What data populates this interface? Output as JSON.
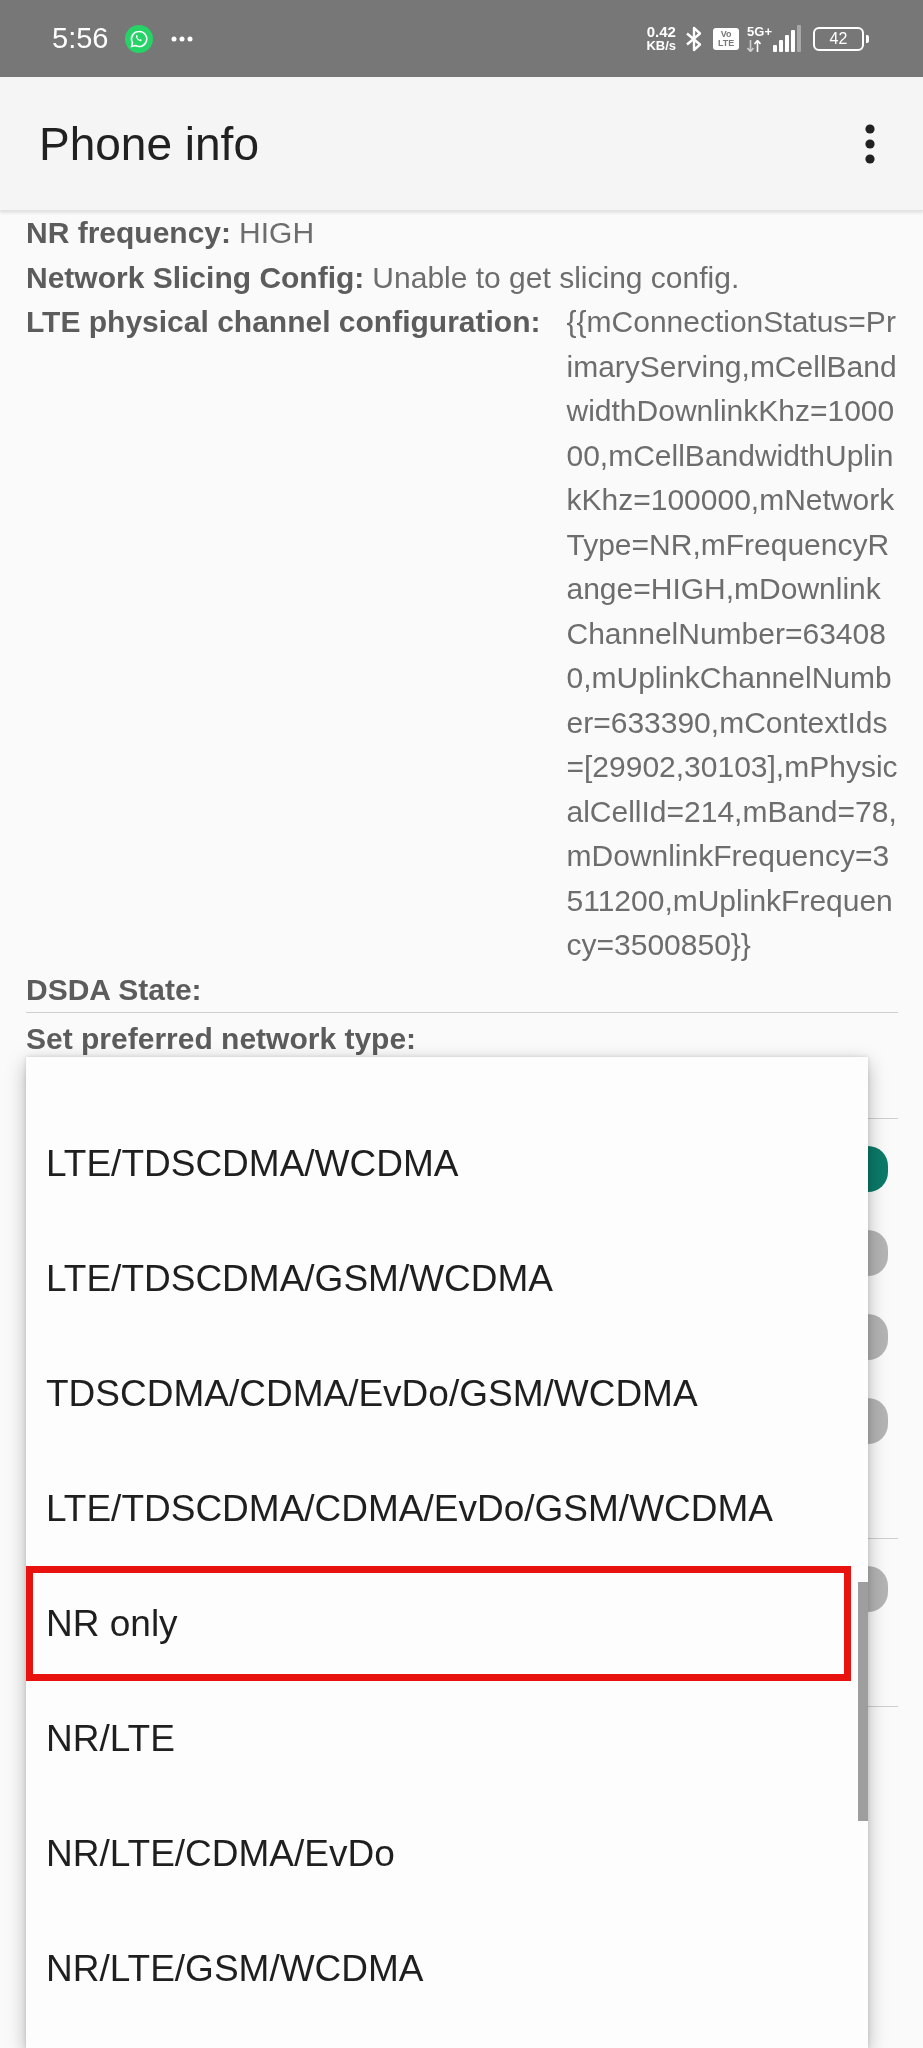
{
  "status_bar": {
    "time": "5:56",
    "speed_value": "0.42",
    "speed_unit": "KB/s",
    "volte_top": "Vo",
    "volte_bottom": "LTE",
    "network_type": "5G+",
    "battery": "42"
  },
  "app_bar": {
    "title": "Phone info"
  },
  "info_rows": [
    {
      "kind": "inline",
      "label": "NR frequency:",
      "value": "HIGH"
    },
    {
      "kind": "inline",
      "label": "Network Slicing Config:",
      "value": "Unable to get slicing config."
    },
    {
      "kind": "column",
      "label": "LTE physical channel configuration:",
      "value": "{{mConnectionStatus=PrimaryServing,mCellBandwidthDownlinkKhz=100000,mCellBandwidthUplinkKhz=100000,mNetworkType=NR,mFrequencyRange=HIGH,mDownlinkChannelNumber=634080,mUplinkChannelNumber=633390,mContextIds=[29902,30103],mPhysicalCellId=214,mBand=78,mDownlinkFrequency=3511200,mUplinkFrequency=3500850}}"
    },
    {
      "kind": "inline",
      "label": "DSDA State:"
    }
  ],
  "preferred_network": {
    "label": "Set preferred network type:"
  },
  "background_groups": [
    {
      "switches": [
        {
          "on": true
        },
        {
          "on": false
        },
        {
          "on": false
        },
        {
          "on": false
        }
      ]
    },
    {
      "switches": [
        {
          "on": false
        }
      ]
    }
  ],
  "network_menu": {
    "items": [
      {
        "label": "LTE/TDSCDMA/WCDMA",
        "highlighted": false
      },
      {
        "label": "LTE/TDSCDMA/GSM/WCDMA",
        "highlighted": false
      },
      {
        "label": "TDSCDMA/CDMA/EvDo/GSM/WCDMA",
        "highlighted": false
      },
      {
        "label": "LTE/TDSCDMA/CDMA/EvDo/GSM/WCDMA",
        "highlighted": false
      },
      {
        "label": "NR only",
        "highlighted": true
      },
      {
        "label": "NR/LTE",
        "highlighted": false
      },
      {
        "label": "NR/LTE/CDMA/EvDo",
        "highlighted": false
      },
      {
        "label": "NR/LTE/GSM/WCDMA",
        "highlighted": false
      }
    ]
  }
}
